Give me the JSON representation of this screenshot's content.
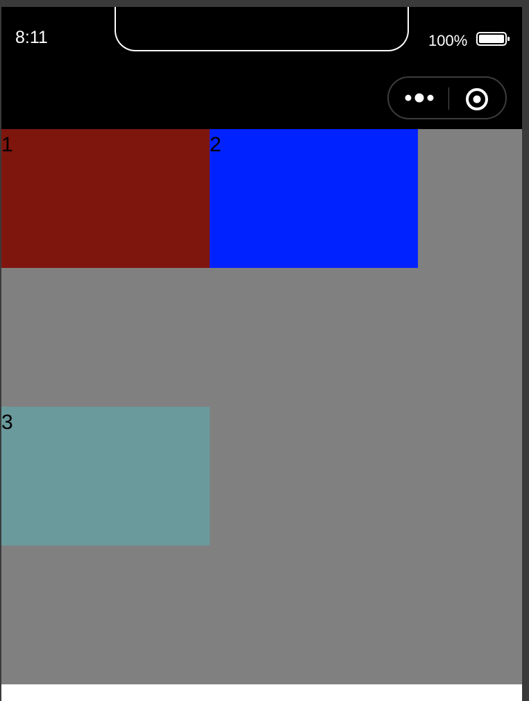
{
  "status_bar": {
    "time": "8:11",
    "battery_percent_text": "100%",
    "battery_level": 1.0
  },
  "capsule": {
    "more_icon": "more-dots-icon",
    "close_icon": "target-circle-icon"
  },
  "colors": {
    "background": "#808080",
    "block_1": "#7f160e",
    "block_2": "#0022ff",
    "block_3": "#6b9a9c"
  },
  "blocks": [
    {
      "label": "1"
    },
    {
      "label": "2"
    },
    {
      "label": "3"
    }
  ]
}
